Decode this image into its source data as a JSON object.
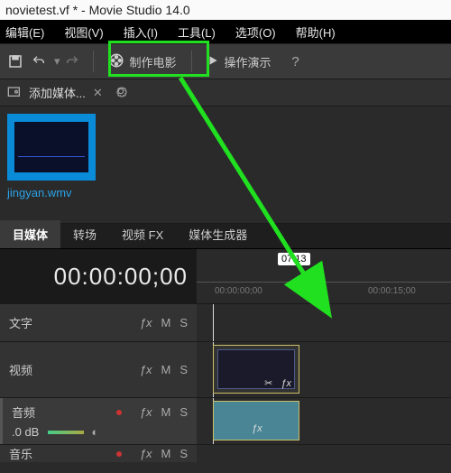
{
  "title": "novietest.vf * - Movie Studio 14.0",
  "menu": {
    "edit": "编辑(E)",
    "view": "视图(V)",
    "insert": "插入(I)",
    "tools": "工具(L)",
    "options": "选项(O)",
    "help": "帮助(H)"
  },
  "toolbar": {
    "make_movie": "制作电影",
    "demo": "操作演示"
  },
  "subbar": {
    "add_media": "添加媒体..."
  },
  "media": {
    "thumb_name": "jingyan.wmv"
  },
  "tabs": {
    "project_media": "目媒体",
    "transitions": "转场",
    "video_fx": "视频 FX",
    "media_generators": "媒体生成器"
  },
  "timecode": "00:00:00;00",
  "marker": "07:13",
  "ruler": {
    "t0": "00:00:00;00",
    "t1": "00:00:15;00"
  },
  "tracks": {
    "text": "文字",
    "video": "视频",
    "audio": "音频",
    "music": "音乐",
    "fx": "ƒx",
    "m": "M",
    "s": "S",
    "db": ".0 dB",
    "crop": "✂",
    "fxs": "ƒx"
  }
}
